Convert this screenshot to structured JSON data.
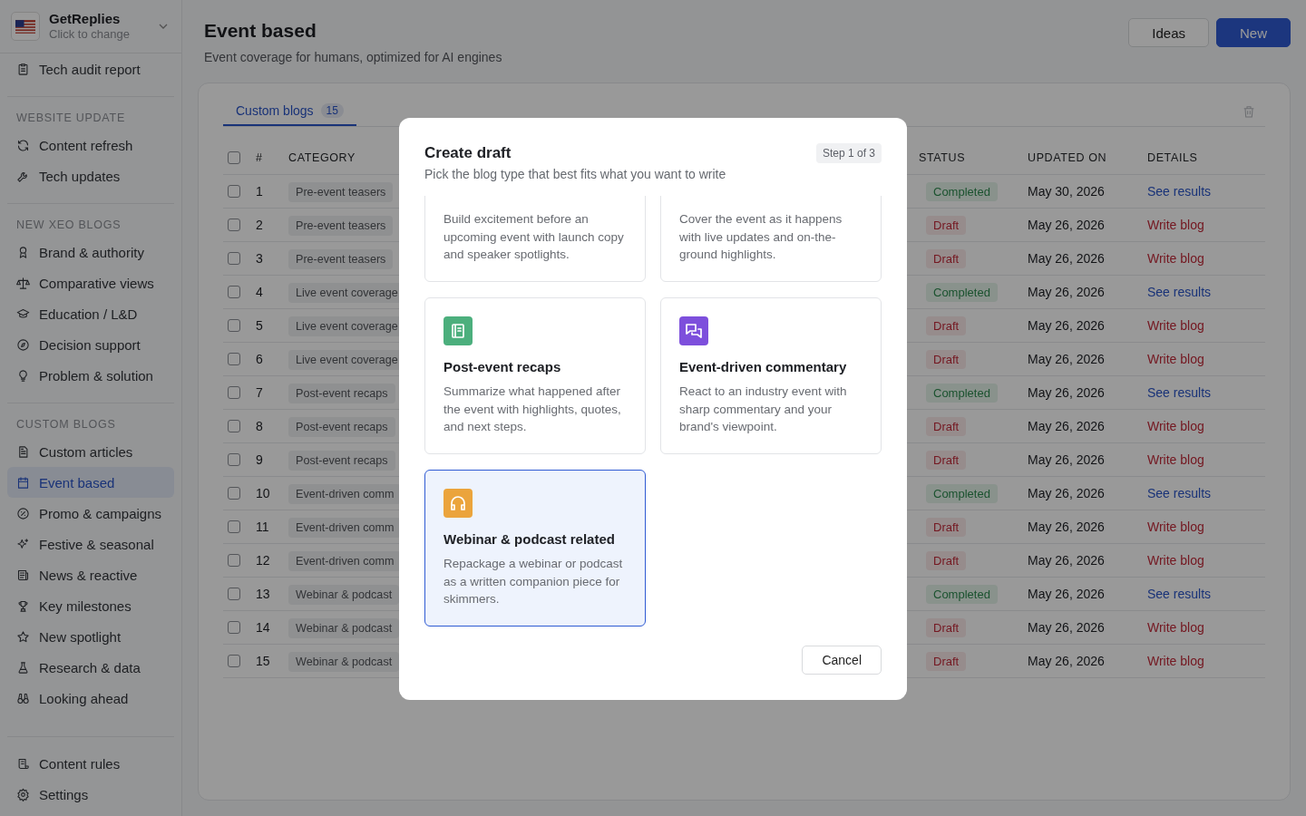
{
  "sidebar": {
    "account": {
      "name": "GetReplies",
      "hint": "Click to change"
    },
    "top_items": [
      {
        "label": "Tech audit report",
        "selected": false
      }
    ],
    "sections": [
      {
        "heading": "WEBSITE UPDATE",
        "items": [
          {
            "label": "Content refresh",
            "selected": false
          },
          {
            "label": "Tech updates",
            "selected": false
          }
        ]
      },
      {
        "heading": "NEW XEO BLOGS",
        "items": [
          {
            "label": "Brand & authority",
            "selected": false
          },
          {
            "label": "Comparative views",
            "selected": false
          },
          {
            "label": "Education / L&D",
            "selected": false
          },
          {
            "label": "Decision support",
            "selected": false
          },
          {
            "label": "Problem & solution",
            "selected": false
          }
        ]
      },
      {
        "heading": "CUSTOM BLOGS",
        "items": [
          {
            "label": "Custom articles",
            "selected": false
          },
          {
            "label": "Event based",
            "selected": true
          },
          {
            "label": "Promo & campaigns",
            "selected": false
          },
          {
            "label": "Festive & seasonal",
            "selected": false
          },
          {
            "label": "News & reactive",
            "selected": false
          },
          {
            "label": "Key milestones",
            "selected": false
          },
          {
            "label": "New spotlight",
            "selected": false
          },
          {
            "label": "Research & data",
            "selected": false
          },
          {
            "label": "Looking ahead",
            "selected": false
          }
        ]
      }
    ],
    "bottom_items": [
      {
        "label": "Content rules",
        "selected": false
      },
      {
        "label": "Settings",
        "selected": false
      }
    ]
  },
  "header": {
    "title": "Event based",
    "subtitle": "Event coverage for humans, optimized for AI engines",
    "buttons": [
      {
        "label": "Ideas",
        "kind": "secondary"
      },
      {
        "label": "New",
        "kind": "primary"
      }
    ]
  },
  "tabs": [
    {
      "label": "Custom blogs",
      "count": "15",
      "selected": true
    }
  ],
  "table": {
    "select_all_checked": false,
    "columns": [
      "#",
      "CATEGORY",
      "STATUS",
      "UPDATED ON",
      "DETAILS"
    ],
    "rows": [
      {
        "checked": false,
        "num": "1",
        "category": "Pre-event teasers",
        "status": "Completed",
        "kind": "completed",
        "updated": "May 30, 2026",
        "details": "See results"
      },
      {
        "checked": false,
        "num": "2",
        "category": "Pre-event teasers",
        "status": "Draft",
        "kind": "draft",
        "updated": "May 26, 2026",
        "details": "Write blog"
      },
      {
        "checked": false,
        "num": "3",
        "category": "Pre-event teasers",
        "status": "Draft",
        "kind": "draft",
        "updated": "May 26, 2026",
        "details": "Write blog"
      },
      {
        "checked": false,
        "num": "4",
        "category": "Live event coverage",
        "status": "Completed",
        "kind": "completed",
        "updated": "May 26, 2026",
        "details": "See results"
      },
      {
        "checked": false,
        "num": "5",
        "category": "Live event coverage",
        "status": "Draft",
        "kind": "draft",
        "updated": "May 26, 2026",
        "details": "Write blog"
      },
      {
        "checked": false,
        "num": "6",
        "category": "Live event coverage",
        "status": "Draft",
        "kind": "draft",
        "updated": "May 26, 2026",
        "details": "Write blog"
      },
      {
        "checked": false,
        "num": "7",
        "category": "Post-event recaps",
        "status": "Completed",
        "kind": "completed",
        "updated": "May 26, 2026",
        "details": "See results"
      },
      {
        "checked": false,
        "num": "8",
        "category": "Post-event recaps",
        "status": "Draft",
        "kind": "draft",
        "updated": "May 26, 2026",
        "details": "Write blog"
      },
      {
        "checked": false,
        "num": "9",
        "category": "Post-event recaps",
        "status": "Draft",
        "kind": "draft",
        "updated": "May 26, 2026",
        "details": "Write blog"
      },
      {
        "checked": false,
        "num": "10",
        "category": "Event-driven comm",
        "status": "Completed",
        "kind": "completed",
        "updated": "May 26, 2026",
        "details": "See results"
      },
      {
        "checked": false,
        "num": "11",
        "category": "Event-driven comm",
        "status": "Draft",
        "kind": "draft",
        "updated": "May 26, 2026",
        "details": "Write blog"
      },
      {
        "checked": false,
        "num": "12",
        "category": "Event-driven comm",
        "status": "Draft",
        "kind": "draft",
        "updated": "May 26, 2026",
        "details": "Write blog"
      },
      {
        "checked": false,
        "num": "13",
        "category": "Webinar & podcast",
        "status": "Completed",
        "kind": "completed",
        "updated": "May 26, 2026",
        "details": "See results"
      },
      {
        "checked": false,
        "num": "14",
        "category": "Webinar & podcast",
        "status": "Draft",
        "kind": "draft",
        "updated": "May 26, 2026",
        "details": "Write blog"
      },
      {
        "checked": false,
        "num": "15",
        "category": "Webinar & podcast",
        "status": "Draft",
        "kind": "draft",
        "updated": "May 26, 2026",
        "details": "Write blog"
      }
    ]
  },
  "dialog": {
    "title": "Create draft",
    "step": "Step 1 of 3",
    "subtitle": "Pick the blog type that best fits what you want to write",
    "options": [
      {
        "description": "Build excitement before an upcoming event with launch copy and speaker spotlights.",
        "selected": false
      },
      {
        "description": "Cover the event as it happens with live updates and on-the-ground highlights.",
        "selected": false
      },
      {
        "title": "Post-event recaps",
        "description": "Summarize what happened after the event with highlights, quotes, and next steps.",
        "color": "#4caf7d",
        "selected": false
      },
      {
        "title": "Event-driven commentary",
        "description": "React to an industry event with sharp commentary and your brand's viewpoint.",
        "color": "#7d4fdc",
        "selected": false
      },
      {
        "title": "Webinar & podcast related",
        "description": "Repackage a webinar or podcast as a written companion piece for skimmers.",
        "color": "#eba43c",
        "selected": true
      }
    ],
    "cancel": "Cancel"
  }
}
